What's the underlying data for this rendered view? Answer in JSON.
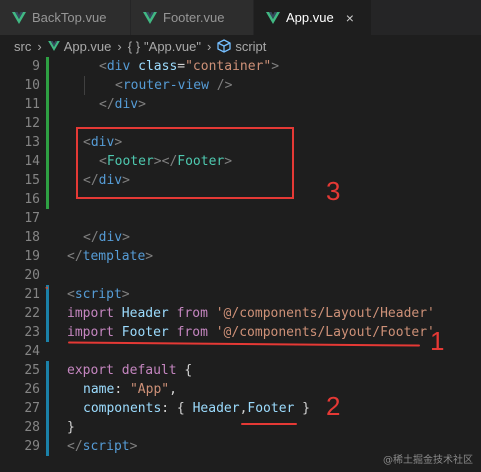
{
  "tabs": [
    {
      "label": "BackTop.vue",
      "active": false
    },
    {
      "label": "Footer.vue",
      "active": false
    },
    {
      "label": "App.vue",
      "active": true
    }
  ],
  "tab_close_glyph": "×",
  "breadcrumb": {
    "folder": "src",
    "file": "App.vue",
    "object_icon": "{ }",
    "object": "\"App.vue\"",
    "section": "script"
  },
  "colors": {
    "background": "#1e1e1e",
    "vue_green": "#41b883",
    "annotation_red": "#e53935",
    "gutter_modified": "#2ea043"
  },
  "code_lines": [
    {
      "num": "9"
    },
    {
      "num": "10"
    },
    {
      "num": "11"
    },
    {
      "num": "12"
    },
    {
      "num": "13"
    },
    {
      "num": "14"
    },
    {
      "num": "15"
    },
    {
      "num": "16"
    },
    {
      "num": "17"
    },
    {
      "num": "18"
    },
    {
      "num": "19"
    },
    {
      "num": "20"
    },
    {
      "num": "21"
    },
    {
      "num": "22"
    },
    {
      "num": "23"
    },
    {
      "num": "24"
    },
    {
      "num": "25"
    },
    {
      "num": "26"
    },
    {
      "num": "27"
    },
    {
      "num": "28"
    },
    {
      "num": "29"
    }
  ],
  "tokens": {
    "div": "div",
    "class_attr": "class",
    "container": "\"container\"",
    "router_view": "router-view",
    "footer": "Footer",
    "template": "template",
    "script": "script",
    "import": "import",
    "from": "from",
    "header": "Header",
    "header_path": "'@/components/Layout/Header'",
    "footer_path": "'@/components/Layout/Footer'",
    "export": "export",
    "default": "default",
    "name_key": "name",
    "app_str": "\"App\"",
    "components_key": "components"
  },
  "annotations": [
    "3",
    "1",
    "2"
  ],
  "watermark": "@稀土掘金技术社区"
}
